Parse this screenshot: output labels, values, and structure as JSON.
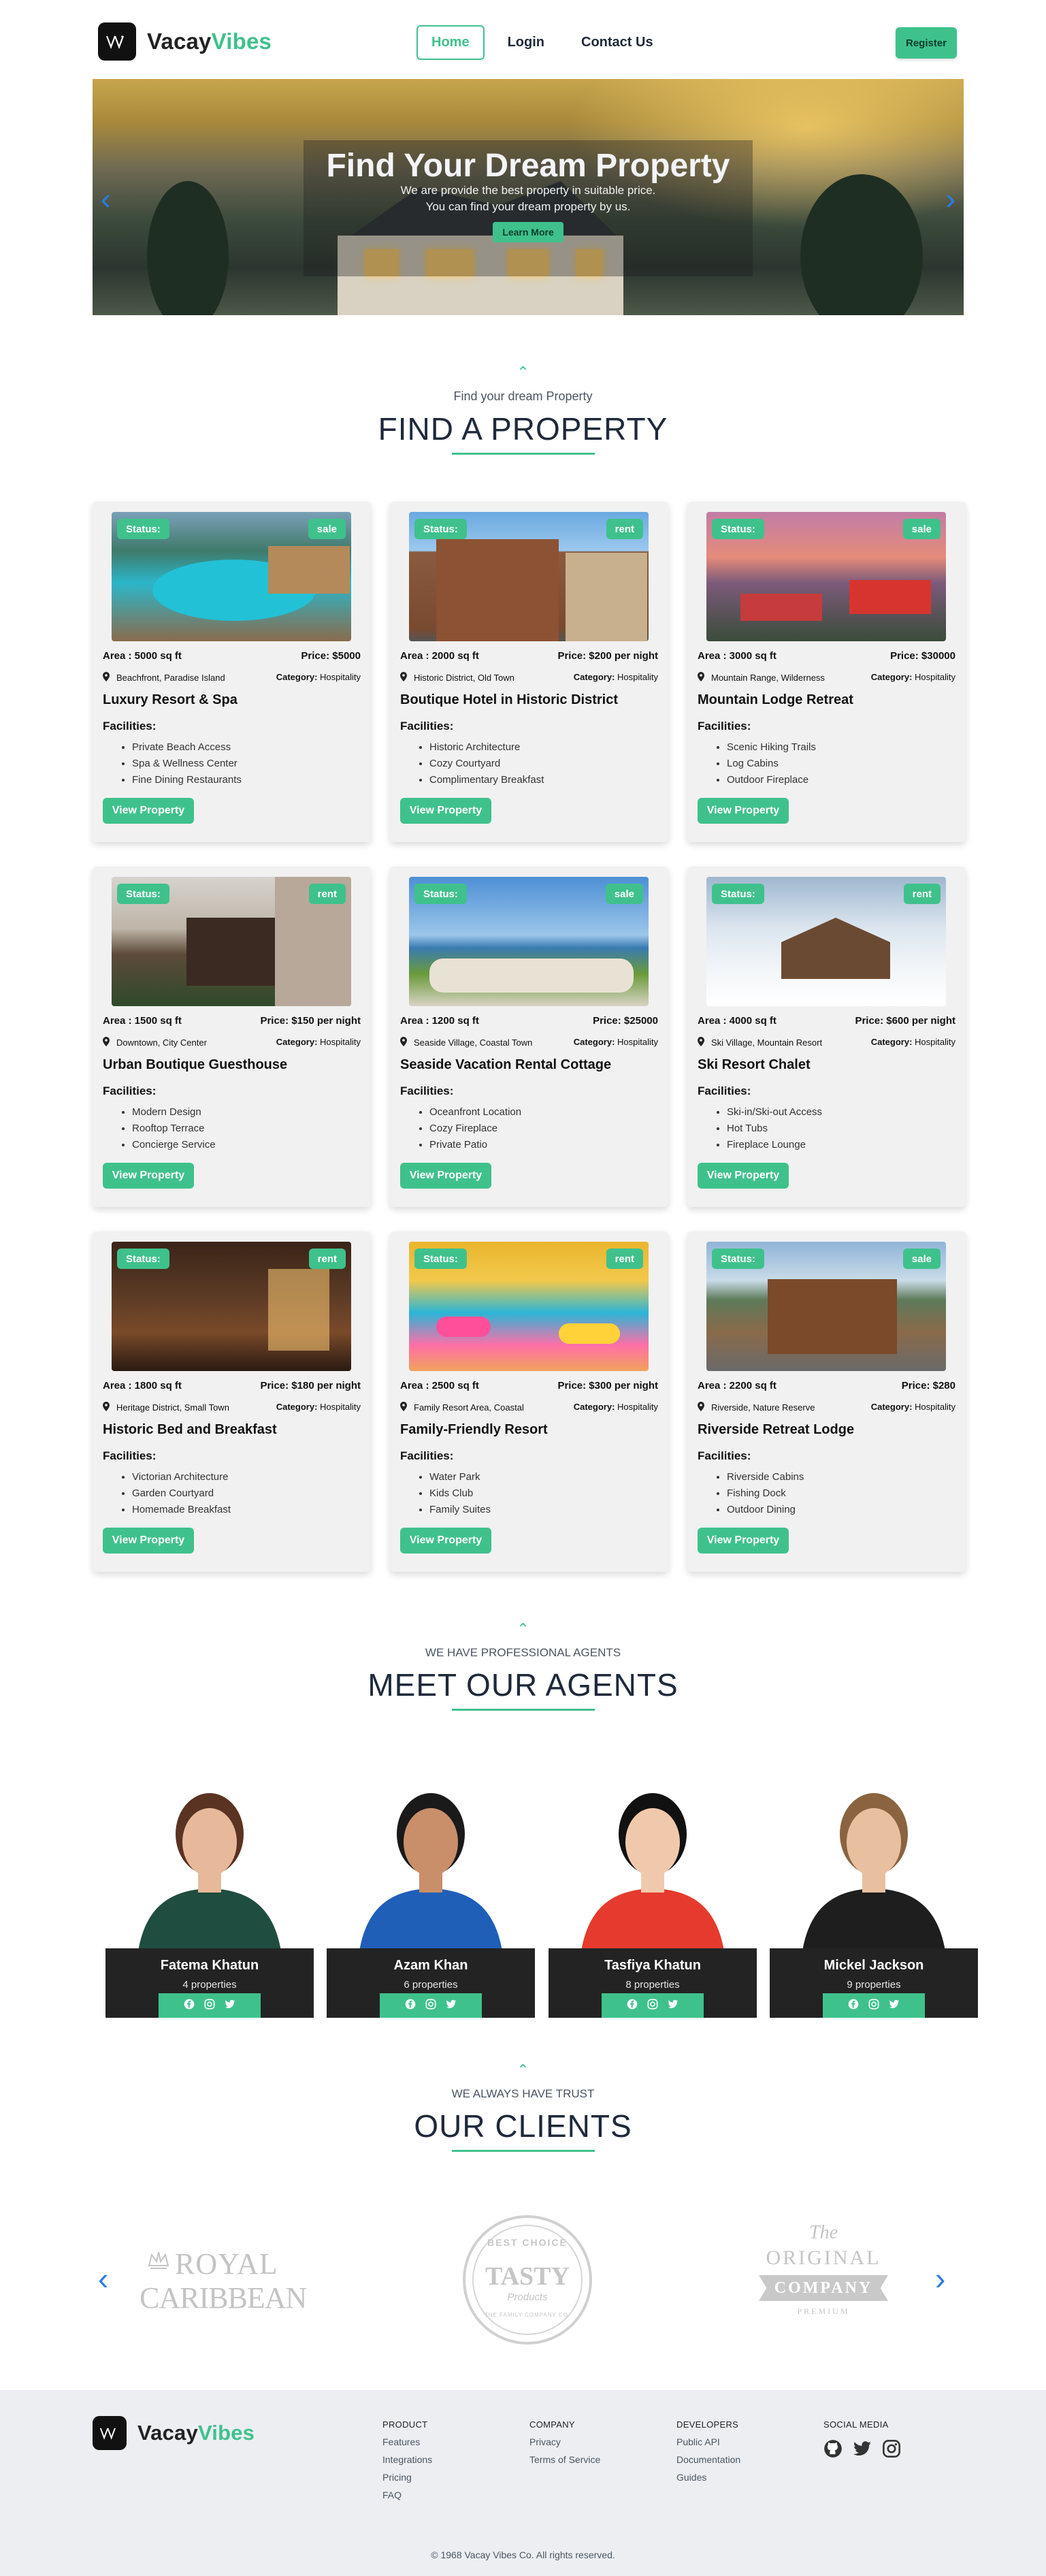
{
  "brand": {
    "name_part1": "Vacay",
    "name_part2": "Vibes",
    "mark": "VV",
    "accent": "#3fc18c",
    "dark": "#111111"
  },
  "nav": {
    "links": [
      {
        "label": "Home",
        "active": true
      },
      {
        "label": "Login"
      },
      {
        "label": "Contact Us"
      }
    ],
    "register_label": "Register"
  },
  "hero": {
    "title": "Find Your Dream Property",
    "subtitle_line1": "We are provide the best property in suitable price.",
    "subtitle_line2": "You can find your dream property by us.",
    "button": "Learn More",
    "prev_icon": "chevron-left-icon",
    "next_icon": "chevron-right-icon"
  },
  "properties_section": {
    "kicker": "Find your dream Property",
    "title": "FIND A PROPERTY"
  },
  "properties": [
    {
      "status": "Status:",
      "type": "sale",
      "area": "Area : 5000 sq ft",
      "price": "Price: $5000",
      "location": "Beachfront, Paradise Island",
      "category_label": "Category:",
      "category": "Hospitality",
      "title": "Luxury Resort & Spa",
      "facilities_label": "Facilities:",
      "facilities": [
        "Private Beach Access",
        "Spa & Wellness Center",
        "Fine Dining Restaurants"
      ],
      "button": "View Property"
    },
    {
      "status": "Status:",
      "type": "rent",
      "area": "Area : 2000 sq ft",
      "price": "Price: $200 per night",
      "location": "Historic District, Old Town",
      "category_label": "Category:",
      "category": "Hospitality",
      "title": "Boutique Hotel in Historic District",
      "facilities_label": "Facilities:",
      "facilities": [
        "Historic Architecture",
        "Cozy Courtyard",
        "Complimentary Breakfast"
      ],
      "button": "View Property"
    },
    {
      "status": "Status:",
      "type": "sale",
      "area": "Area : 3000 sq ft",
      "price": "Price: $30000",
      "location": "Mountain Range, Wilderness",
      "category_label": "Category:",
      "category": "Hospitality",
      "title": "Mountain Lodge Retreat",
      "facilities_label": "Facilities:",
      "facilities": [
        "Scenic Hiking Trails",
        "Log Cabins",
        "Outdoor Fireplace"
      ],
      "button": "View Property"
    },
    {
      "status": "Status:",
      "type": "rent",
      "area": "Area : 1500 sq ft",
      "price": "Price: $150 per night",
      "location": "Downtown, City Center",
      "category_label": "Category:",
      "category": "Hospitality",
      "title": "Urban Boutique Guesthouse",
      "facilities_label": "Facilities:",
      "facilities": [
        "Modern Design",
        "Rooftop Terrace",
        "Concierge Service"
      ],
      "button": "View Property"
    },
    {
      "status": "Status:",
      "type": "sale",
      "area": "Area : 1200 sq ft",
      "price": "Price: $25000",
      "location": "Seaside Village, Coastal Town",
      "category_label": "Category:",
      "category": "Hospitality",
      "title": "Seaside Vacation Rental Cottage",
      "facilities_label": "Facilities:",
      "facilities": [
        "Oceanfront Location",
        "Cozy Fireplace",
        "Private Patio"
      ],
      "button": "View Property"
    },
    {
      "status": "Status:",
      "type": "rent",
      "area": "Area : 4000 sq ft",
      "price": "Price: $600 per night",
      "location": "Ski Village, Mountain Resort",
      "category_label": "Category:",
      "category": "Hospitality",
      "title": "Ski Resort Chalet",
      "facilities_label": "Facilities:",
      "facilities": [
        "Ski-in/Ski-out Access",
        "Hot Tubs",
        "Fireplace Lounge"
      ],
      "button": "View Property"
    },
    {
      "status": "Status:",
      "type": "rent",
      "area": "Area : 1800 sq ft",
      "price": "Price: $180 per night",
      "location": "Heritage District, Small Town",
      "category_label": "Category:",
      "category": "Hospitality",
      "title": "Historic Bed and Breakfast",
      "facilities_label": "Facilities:",
      "facilities": [
        "Victorian Architecture",
        "Garden Courtyard",
        "Homemade Breakfast"
      ],
      "button": "View Property"
    },
    {
      "status": "Status:",
      "type": "rent",
      "area": "Area : 2500 sq ft",
      "price": "Price: $300 per night",
      "location": "Family Resort Area, Coastal",
      "category_label": "Category:",
      "category": "Hospitality",
      "title": "Family-Friendly Resort",
      "facilities_label": "Facilities:",
      "facilities": [
        "Water Park",
        "Kids Club",
        "Family Suites"
      ],
      "button": "View Property"
    },
    {
      "status": "Status:",
      "type": "sale",
      "area": "Area : 2200 sq ft",
      "price": "Price: $280",
      "location": "Riverside, Nature Reserve",
      "category_label": "Category:",
      "category": "Hospitality",
      "title": "Riverside Retreat Lodge",
      "facilities_label": "Facilities:",
      "facilities": [
        "Riverside Cabins",
        "Fishing Dock",
        "Outdoor Dining"
      ],
      "button": "View Property"
    }
  ],
  "agents_section": {
    "kicker": "WE HAVE PROFESSIONAL AGENTS",
    "title": "MEET OUR AGENTS"
  },
  "agents": [
    {
      "name": "Fatema Khatun",
      "properties": "4 properties",
      "social_icons": [
        "facebook-icon",
        "instagram-icon",
        "twitter-icon"
      ]
    },
    {
      "name": "Azam Khan",
      "properties": "6 properties",
      "social_icons": [
        "facebook-icon",
        "instagram-icon",
        "twitter-icon"
      ]
    },
    {
      "name": "Tasfiya Khatun",
      "properties": "8 properties",
      "social_icons": [
        "facebook-icon",
        "instagram-icon",
        "twitter-icon"
      ]
    },
    {
      "name": "Mickel Jackson",
      "properties": "9 properties",
      "social_icons": [
        "facebook-icon",
        "instagram-icon",
        "twitter-icon"
      ]
    }
  ],
  "clients_section": {
    "kicker": "WE ALWAYS HAVE TRUST",
    "title": "OUR CLIENTS"
  },
  "clients": [
    {
      "logo_line1": "ROYAL",
      "logo_line2": "CARIBBEAN"
    },
    {
      "logo_top": "BEST CHOICE",
      "logo_main": "TASTY",
      "logo_sub": "Products",
      "logo_bottom": "THE FAMILY COMPANY CO."
    },
    {
      "logo_top": "The",
      "logo_main": "ORIGINAL",
      "logo_ribbon": "COMPANY",
      "logo_bottom": "PREMIUM"
    }
  ],
  "footer": {
    "columns": [
      {
        "head": "PRODUCT",
        "items": [
          "Features",
          "Integrations",
          "Pricing",
          "FAQ"
        ]
      },
      {
        "head": "COMPANY",
        "items": [
          "Privacy",
          "Terms of Service"
        ]
      },
      {
        "head": "DEVELOPERS",
        "items": [
          "Public API",
          "Documentation",
          "Guides"
        ]
      }
    ],
    "social_head": "SOCIAL MEDIA",
    "social_icons": [
      "github-icon",
      "twitter-icon",
      "instagram-icon"
    ],
    "copyright": "© 1968 Vacay Vibes Co. All rights reserved."
  }
}
